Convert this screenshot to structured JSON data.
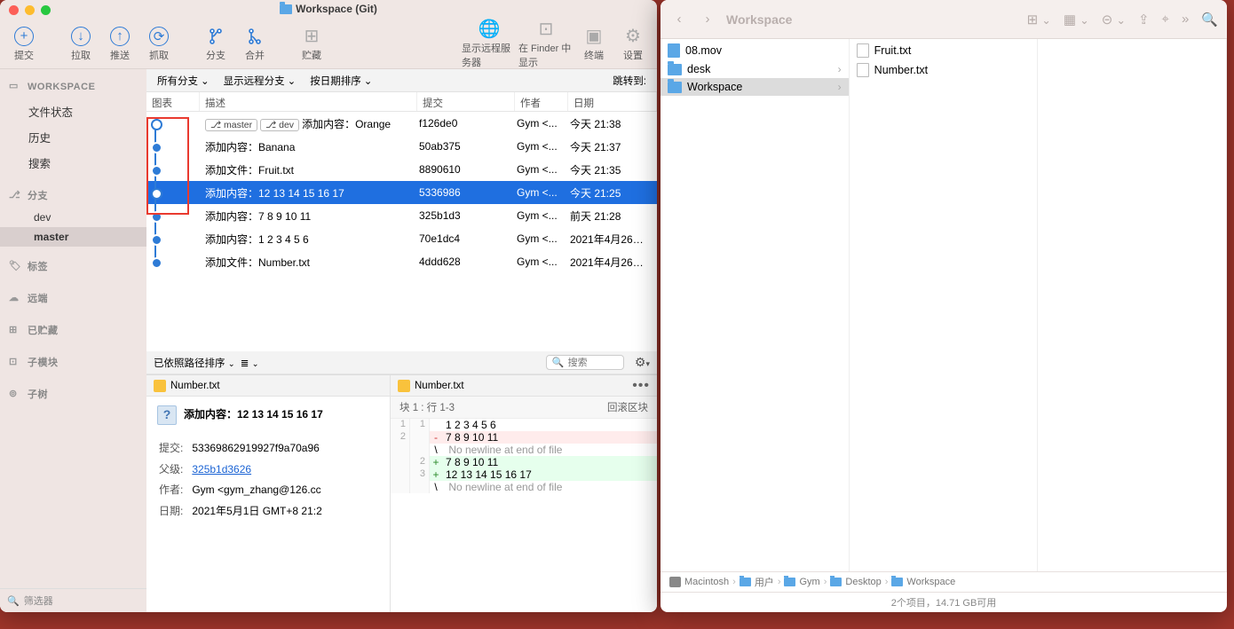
{
  "sourcetree": {
    "title": "Workspace (Git)",
    "toolbar": {
      "commit": "提交",
      "pull": "拉取",
      "push": "推送",
      "fetch": "抓取",
      "branch": "分支",
      "merge": "合并",
      "stash": "贮藏",
      "remote": "显示远程服务器",
      "finder": "在 Finder 中显示",
      "terminal": "终端",
      "settings": "设置"
    },
    "sidebar": {
      "workspace_hdr": "WORKSPACE",
      "file_status": "文件状态",
      "history": "历史",
      "search": "搜索",
      "branches_hdr": "分支",
      "branches": [
        "dev",
        "master"
      ],
      "tags_hdr": "标签",
      "remotes_hdr": "远端",
      "stashes_hdr": "已贮藏",
      "submodules_hdr": "子模块",
      "subtrees_hdr": "子树",
      "filter_placeholder": "筛选器"
    },
    "filter_bar": {
      "all_branches": "所有分支",
      "show_remote": "显示远程分支",
      "order": "按日期排序",
      "jump_to": "跳转到:"
    },
    "columns": {
      "graph": "图表",
      "desc": "描述",
      "commit": "提交",
      "author": "作者",
      "date": "日期"
    },
    "commits": [
      {
        "tags": [
          "master",
          "dev"
        ],
        "desc": "添加内容：Orange",
        "hash": "f126de0",
        "author": "Gym <...",
        "date": "今天 21:38",
        "dot": "open",
        "lane": 1
      },
      {
        "tags": [],
        "desc": "添加内容：Banana",
        "hash": "50ab375",
        "author": "Gym <...",
        "date": "今天 21:37",
        "dot": "solid",
        "lane": 1
      },
      {
        "tags": [],
        "desc": "添加文件：Fruit.txt",
        "hash": "8890610",
        "author": "Gym <...",
        "date": "今天 21:35",
        "dot": "solid",
        "lane": 1
      },
      {
        "tags": [],
        "desc": "添加内容：12 13 14 15 16 17",
        "hash": "5336986",
        "author": "Gym <...",
        "date": "今天 21:25",
        "dot": "open",
        "lane": 1,
        "selected": true
      },
      {
        "tags": [],
        "desc": "添加内容：7 8 9 10 11",
        "hash": "325b1d3",
        "author": "Gym <...",
        "date": "前天 21:28",
        "dot": "solid",
        "lane": 1
      },
      {
        "tags": [],
        "desc": "添加内容：1 2 3 4 5 6",
        "hash": "70e1dc4",
        "author": "Gym <...",
        "date": "2021年4月26日...",
        "dot": "solid",
        "lane": 1
      },
      {
        "tags": [],
        "desc": "添加文件：Number.txt",
        "hash": "4ddd628",
        "author": "Gym <...",
        "date": "2021年4月26日...",
        "dot": "solid",
        "lane": 1
      }
    ],
    "detail_bar": {
      "sort": "已依照路径排序",
      "search_placeholder": "搜索"
    },
    "file_tab": "Number.txt",
    "commit_detail": {
      "title": "添加内容：12 13 14 15 16 17",
      "labels": {
        "commit": "提交:",
        "parent": "父级:",
        "author": "作者:",
        "date": "日期:"
      },
      "commit": "53369862919927f9a70a96",
      "parent": "325b1d3626",
      "author": "Gym <gym_zhang@126.cc",
      "date": "2021年5月1日 GMT+8 21:2"
    },
    "diff": {
      "file": "Number.txt",
      "hunk": "块 1 : 行 1-3",
      "revert": "回滚区块",
      "lines": [
        {
          "o": "1",
          "n": "1",
          "m": " ",
          "t": "1 2 3 4 5 6"
        },
        {
          "o": "2",
          "n": "",
          "m": "-",
          "t": "7 8 9 10 11",
          "cls": "del"
        },
        {
          "o": "",
          "n": "",
          "m": "\\",
          "t": " No newline at end of file",
          "cls": "meta"
        },
        {
          "o": "",
          "n": "2",
          "m": "+",
          "t": "7 8 9 10 11",
          "cls": "add"
        },
        {
          "o": "",
          "n": "3",
          "m": "+",
          "t": "12 13 14 15 16 17",
          "cls": "add"
        },
        {
          "o": "",
          "n": "",
          "m": "\\",
          "t": " No newline at end of file",
          "cls": "meta"
        }
      ]
    }
  },
  "finder": {
    "title": "Workspace",
    "col1": [
      {
        "name": "08.mov",
        "type": "mov"
      },
      {
        "name": "desk",
        "type": "folder",
        "chev": true
      },
      {
        "name": "Workspace",
        "type": "folder",
        "chev": true,
        "selected": true
      }
    ],
    "col2": [
      {
        "name": "Fruit.txt",
        "type": "file"
      },
      {
        "name": "Number.txt",
        "type": "file"
      }
    ],
    "path": [
      "Macintosh",
      "用户",
      "Gym",
      "Desktop",
      "Workspace"
    ],
    "status": "2个项目，14.71 GB可用"
  }
}
